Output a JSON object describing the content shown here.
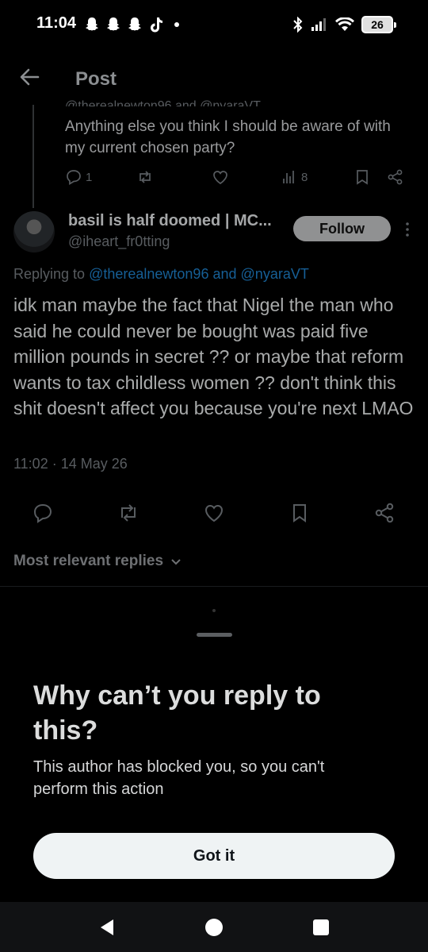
{
  "status_bar": {
    "time": "11:04",
    "notification_icons": [
      "snapchat-icon",
      "snapchat-icon",
      "snapchat-icon",
      "tiktok-icon"
    ],
    "battery": "26"
  },
  "header": {
    "title": "Post"
  },
  "parent_post": {
    "cut_text": "@therealnewton96 and @nyaraVT",
    "text": "Anything else you think I should be aware of with my current chosen party?",
    "reply_count": "1",
    "views": "8"
  },
  "post": {
    "author_name": "basil is half doomed | MC...",
    "author_handle": "@iheart_fr0tting",
    "follow_label": "Follow",
    "replying_prefix": "Replying to",
    "mention_1": "@therealnewton96",
    "mention_join": "and",
    "mention_2": "@nyaraVT",
    "body": "idk man maybe the fact that Nigel the man who said he could never be bought was paid five million pounds in secret ?? or maybe that reform wants to tax childless women ?? don't think this shit doesn't affect you because you're next LMAO",
    "timestamp": "11:02 · 14 May 26"
  },
  "replies_sort": {
    "label": "Most relevant replies"
  },
  "sheet": {
    "title": "Why can’t you reply to this?",
    "body": "This author has blocked you, so you can't perform this action",
    "button_label": "Got it"
  },
  "colors": {
    "background": "#000000",
    "accent_link": "#1d7ac0",
    "button_light": "#eff3f4"
  }
}
